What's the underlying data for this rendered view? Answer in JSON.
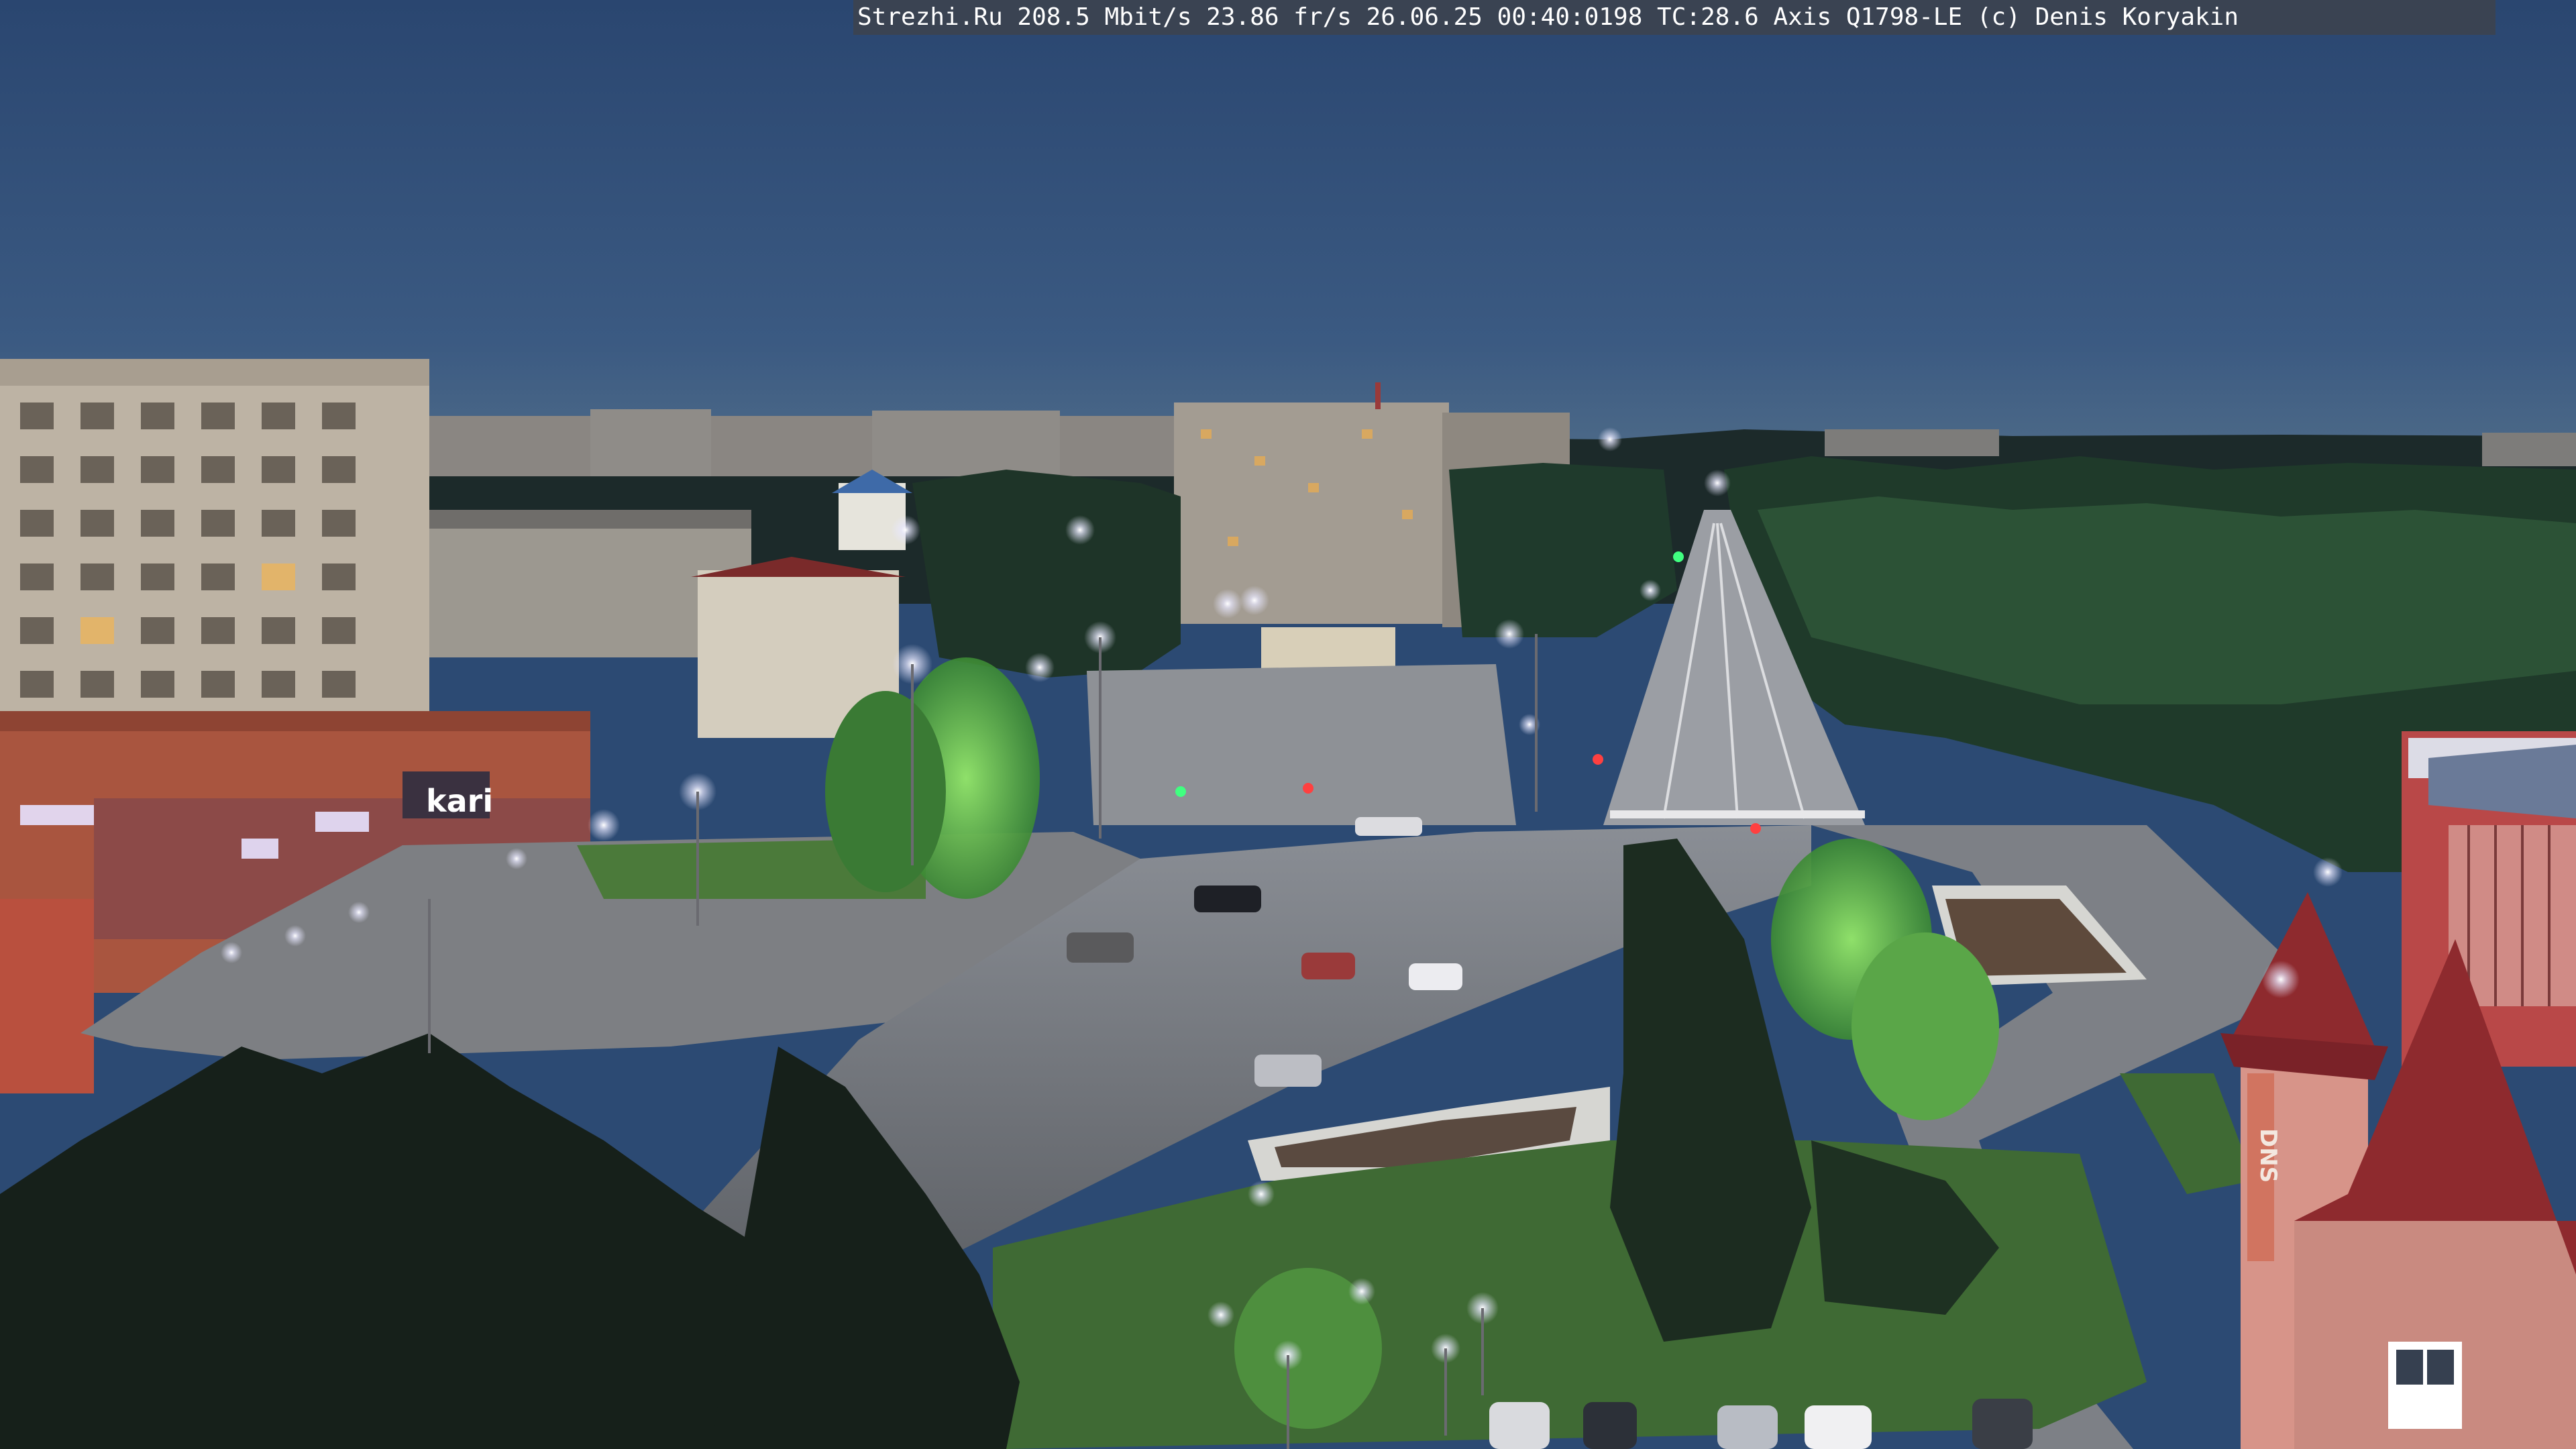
{
  "camera_overlay": {
    "text": "Strezhi.Ru 208.5 Mbit/s 23.86 fr/s 26.06.25 00:40:0198 TC:28.6  Axis Q1798-LE  (c) Denis Koryakin"
  },
  "signs": {
    "store_sign": "kari",
    "right_building_sign": "DNS"
  },
  "colors": {
    "sky_top": "#2b4872",
    "sky_horizon": "#4a6a8c",
    "road": "#6b6e72",
    "tree_dark": "#1e2a22",
    "tree_lit": "#4fa040",
    "street_light": "#f2f0ff",
    "store_facade": "#a9553f",
    "right_building_roof": "#8e2a2e"
  }
}
